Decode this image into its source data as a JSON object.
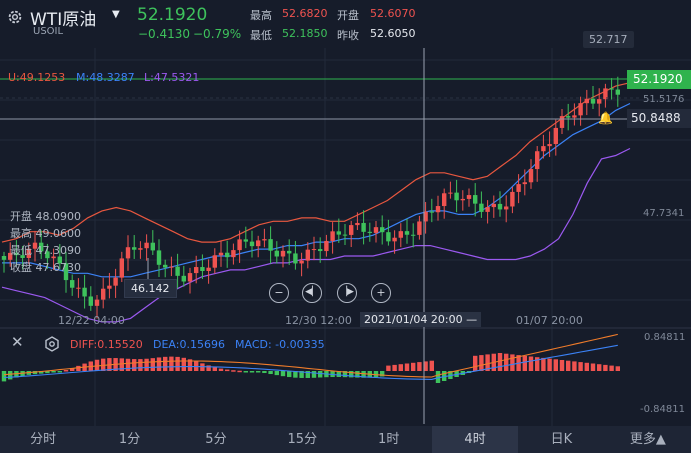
{
  "header": {
    "symbol": "WTI原油",
    "code": "USOIL",
    "price": "52.1920",
    "change": "−0.4130",
    "change_pct": "−0.79%",
    "high_label": "最高",
    "high": "52.6820",
    "open_label": "开盘",
    "open": "52.6070",
    "low_label": "最低",
    "low": "52.1850",
    "prev_label": "昨收",
    "prev": "52.6050"
  },
  "indicators": {
    "upper": "U:49.1253",
    "mid": "M:48.3287",
    "lower": "L:47.5321"
  },
  "axis": {
    "top_value": "52.717",
    "p1": "51.5176",
    "p2": "47.7341",
    "current_price": "52.1920",
    "alert_price": "50.8488",
    "x_labels": [
      "12/22 04:00",
      "12/30 12:00",
      "01/07 20:00"
    ],
    "crosshair_time": "2021/01/04 20:00 —"
  },
  "ohlc_panel": {
    "open": "开盘 48.0900",
    "high": "最高 49.0600",
    "low": "最低 47.3090",
    "close": "收盘 47.6730"
  },
  "low_marker": "46.142",
  "macd": {
    "diff": "DIFF:0.15520",
    "dea": "DEA:0.15696",
    "macd": "MACD: -0.00335",
    "top": "0.84811",
    "bottom": "-0.84811"
  },
  "tabs": [
    "分时",
    "1分",
    "5分",
    "15分",
    "1时",
    "4时",
    "日K",
    "更多▲"
  ],
  "colors": {
    "up": "#ef5350",
    "down": "#3ec25c",
    "upper_band": "#e8573f",
    "mid_band": "#3b82f6",
    "lower_band": "#9b59f0",
    "diff": "#f07c2a",
    "dea": "#3b82f6"
  },
  "chart_data": {
    "type": "candlestick",
    "series": [
      {
        "name": "U",
        "values": [
          47.5,
          47.6,
          47.8,
          47.8,
          47.7,
          47.9,
          48.2,
          48.4,
          48.5,
          48.4,
          48.2,
          48.0,
          47.8,
          47.6,
          47.5,
          47.5,
          47.6,
          47.8,
          48.0,
          48.1,
          48.1,
          48.2,
          48.2,
          48.1,
          48.1,
          48.3,
          48.5,
          48.7,
          49.0,
          49.3,
          49.5,
          49.5,
          49.4,
          49.3,
          49.4,
          49.7,
          50.0,
          50.4,
          50.7,
          51.0,
          51.3,
          51.6,
          51.8,
          52.0,
          52.1
        ]
      },
      {
        "name": "M",
        "values": [
          46.9,
          46.9,
          46.9,
          46.8,
          46.7,
          46.6,
          46.6,
          46.5,
          46.5,
          46.5,
          46.6,
          46.7,
          46.8,
          46.9,
          47.0,
          47.1,
          47.1,
          47.2,
          47.3,
          47.3,
          47.4,
          47.4,
          47.5,
          47.5,
          47.6,
          47.6,
          47.7,
          47.9,
          48.1,
          48.3,
          48.4,
          48.4,
          48.3,
          48.3,
          48.5,
          48.8,
          49.2,
          49.6,
          50.0,
          50.3,
          50.6,
          50.8,
          51.0,
          51.3,
          51.5
        ]
      },
      {
        "name": "L",
        "values": [
          46.2,
          46.1,
          46.0,
          45.9,
          45.7,
          45.5,
          45.3,
          45.2,
          45.2,
          45.3,
          45.6,
          45.9,
          46.1,
          46.3,
          46.5,
          46.6,
          46.7,
          46.7,
          46.8,
          46.9,
          46.9,
          47.0,
          47.0,
          47.0,
          47.1,
          47.1,
          47.1,
          47.2,
          47.3,
          47.4,
          47.4,
          47.3,
          47.2,
          47.1,
          47.0,
          47.0,
          47.0,
          47.1,
          47.3,
          47.6,
          48.3,
          49.2,
          49.9,
          50.0,
          50.2
        ]
      }
    ]
  }
}
